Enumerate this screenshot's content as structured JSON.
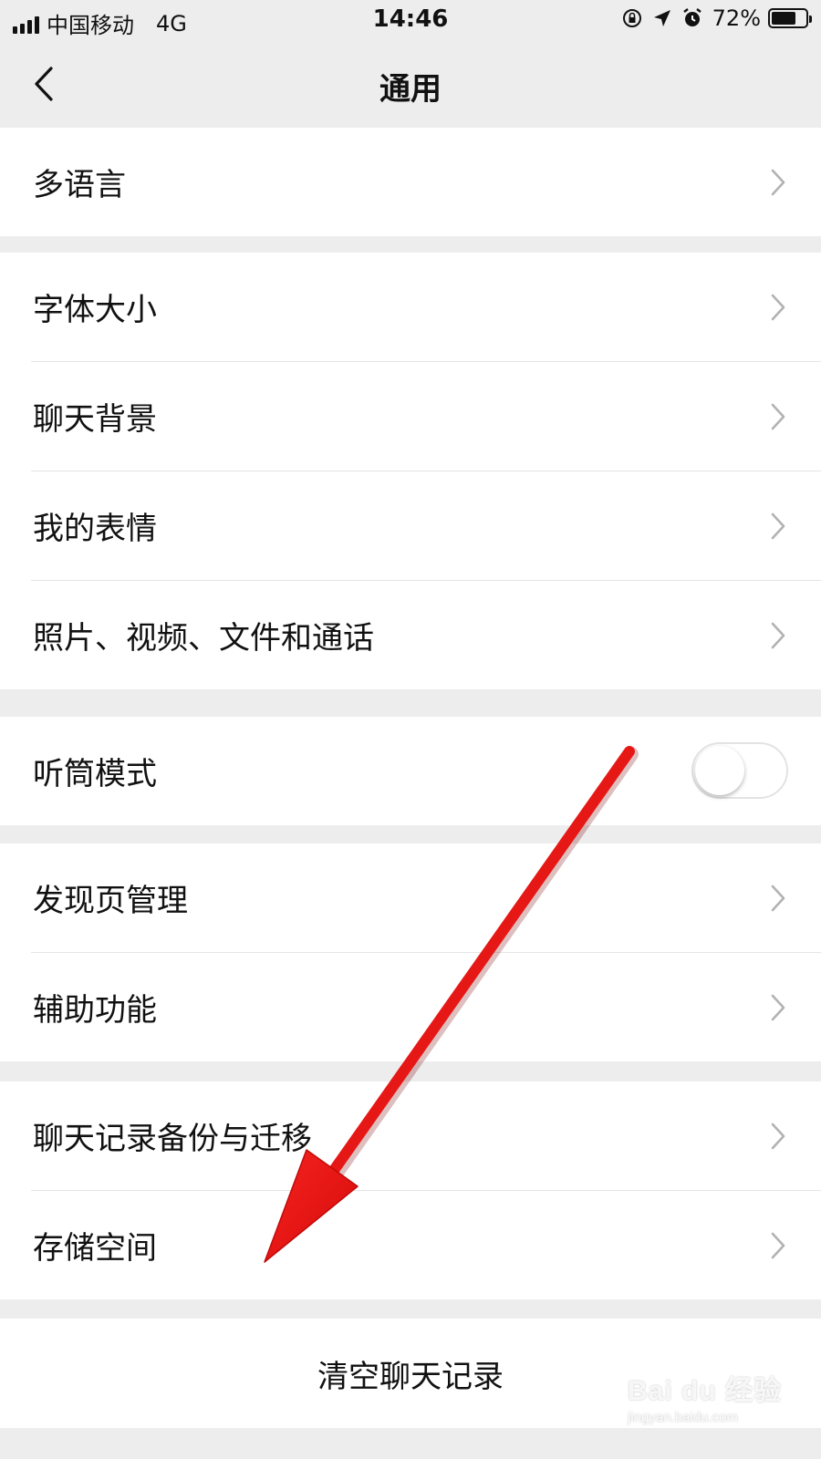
{
  "status_bar": {
    "carrier": "中国移动",
    "network": "4G",
    "time": "14:46",
    "battery": "72%",
    "battery_level": 0.72,
    "icons": [
      "rotation-lock-icon",
      "location-arrow-icon",
      "alarm-icon"
    ]
  },
  "nav": {
    "title": "通用",
    "back_icon": "chevron-left-icon"
  },
  "settings": {
    "language": "多语言",
    "font_size": "字体大小",
    "chat_background": "聊天背景",
    "my_stickers": "我的表情",
    "photos_videos_files": "照片、视频、文件和通话",
    "earpiece_mode": "听筒模式",
    "earpiece_mode_on": false,
    "discover_management": "发现页管理",
    "accessibility": "辅助功能",
    "chat_backup": "聊天记录备份与迁移",
    "storage": "存储空间"
  },
  "clear_chat_history": "清空聊天记录",
  "watermark": {
    "logo": "Bai du 经验",
    "url": "jingyan.baidu.com"
  },
  "colors": {
    "background": "#ededed",
    "cell": "#ffffff",
    "chevron": "#b2b2b2",
    "arrow": "#e8100f"
  }
}
